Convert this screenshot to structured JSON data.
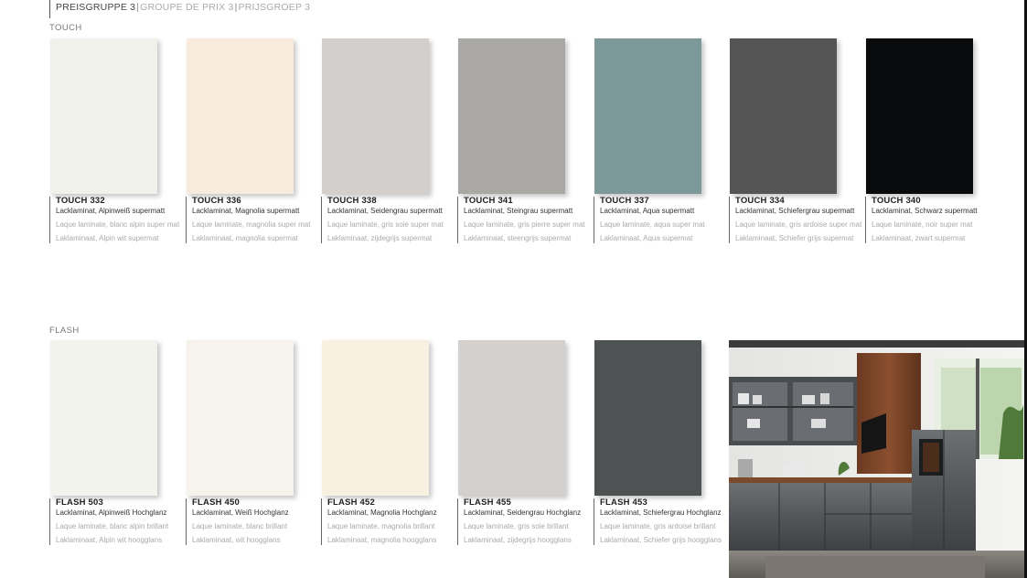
{
  "header": {
    "primary": "PREISGRUPPE 3",
    "secondary": "GROUPE DE PRIX 3",
    "tertiary": "PRIJSGROEP 3"
  },
  "touch": {
    "label": "TOUCH",
    "items": [
      {
        "code": "TOUCH 332",
        "de": "Lacklaminat, Alpinweiß supermatt",
        "fr": "Laque laminate, blanc alpin super mat",
        "nl": "Laklaminaat, Alpin wit supermat",
        "color": "#f1f1ec"
      },
      {
        "code": "TOUCH 336",
        "de": "Lacklaminat, Magnolia supermatt",
        "fr": "Laque laminate, magnolia super mat",
        "nl": "Laklaminaat, magnolia supermat",
        "color": "#f8ebde"
      },
      {
        "code": "TOUCH 338",
        "de": "Lacklaminat, Seidengrau supermatt",
        "fr": "Laque laminate, gris soie super mat",
        "nl": "Laklaminaat, zijdegrijs supermat",
        "color": "#d2cfcc"
      },
      {
        "code": "TOUCH 341",
        "de": "Lacklaminat, Steingrau supermatt",
        "fr": "Laque laminate, gris pierre super mat",
        "nl": "Laklaminaat, steengrijs supermat",
        "color": "#a9a8a4"
      },
      {
        "code": "TOUCH 337",
        "de": "Lacklaminat, Aqua supermatt",
        "fr": "Laque laminate, aqua super mat",
        "nl": "Laklaminaat, Aqua supermat",
        "color": "#7c9899"
      },
      {
        "code": "TOUCH 334",
        "de": "Lacklaminat, Schiefergrau supermatt",
        "fr": "Laque laminate, gris ardoise super mat",
        "nl": "Laklaminaat, Schiefer grijs supermat",
        "color": "#555556"
      },
      {
        "code": "TOUCH 340",
        "de": "Lacklaminat, Schwarz supermatt",
        "fr": "Laque laminate, noir super mat",
        "nl": "Laklaminaat, zwart supermat",
        "color": "#0a0b0d"
      }
    ]
  },
  "flash": {
    "label": "FLASH",
    "items": [
      {
        "code": "FLASH 503",
        "de": "Lacklaminat, Alpinweiß Hochglanz",
        "fr": "Laque laminate, blanc alpin brillant",
        "nl": "Laklaminaat, Alpin wit hoogglans",
        "color": "#f3f3ee"
      },
      {
        "code": "FLASH 450",
        "de": "Lacklaminat, Weiß Hochglanz",
        "fr": "Laque laminate, blanc brillant",
        "nl": "Laklaminaat, wit hoogglans",
        "color": "#f5f3ec"
      },
      {
        "code": "FLASH 452",
        "de": "Lacklaminat, Magnolia Hochglanz",
        "fr": "Laque laminate, magnolia brillant",
        "nl": "Laklaminaat, magnolia hoogglans",
        "color": "#f8f1e2"
      },
      {
        "code": "FLASH 455",
        "de": "Lacklaminat, Seidengrau Hochglanz",
        "fr": "Laque laminate, gris soie brillant",
        "nl": "Laklaminaat, zijdegrijs hoogglans",
        "color": "#d3d0cd"
      },
      {
        "code": "FLASH 453",
        "de": "Lacklaminat, Schiefergrau Hochglanz",
        "fr": "Laque laminate, gris ardoise brillant",
        "nl": "Laklaminaat, Schiefer grijs hoogglans",
        "color": "#4f5253"
      }
    ]
  }
}
